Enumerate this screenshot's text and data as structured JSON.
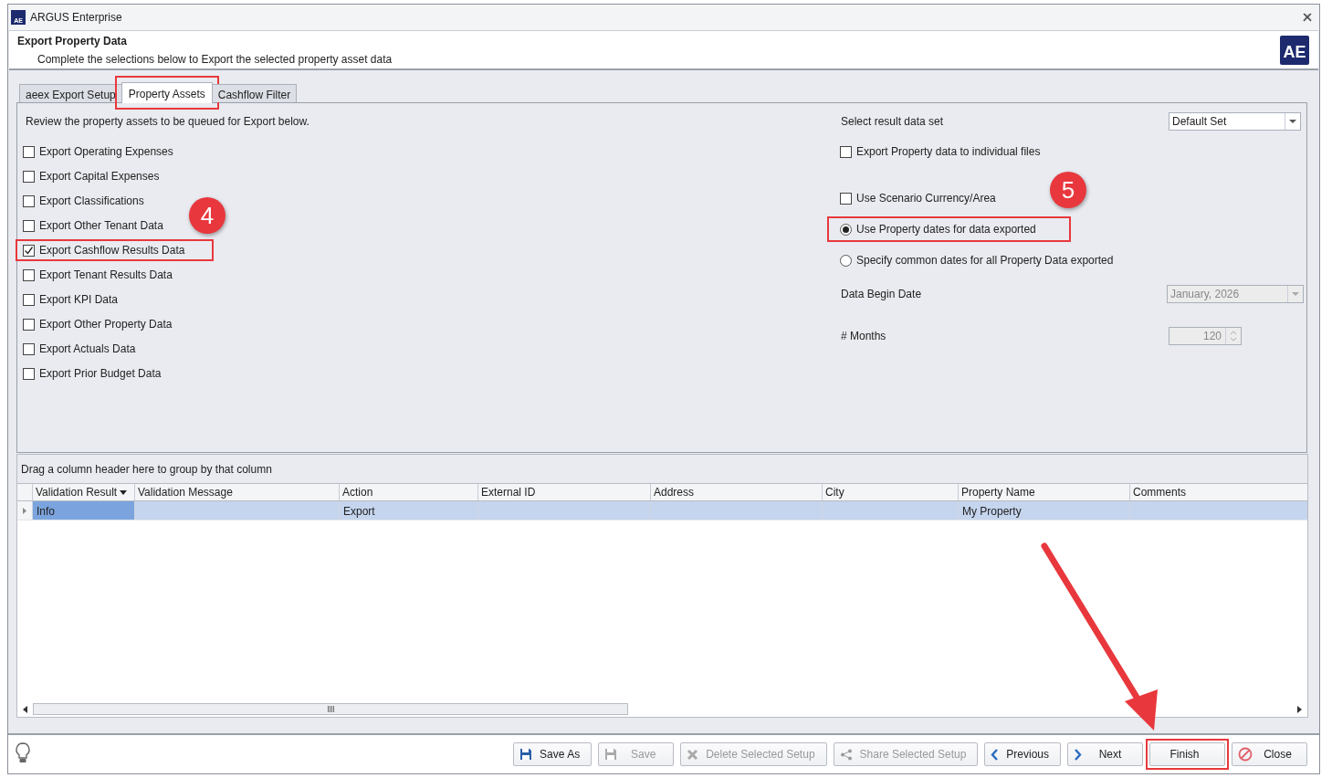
{
  "window": {
    "title": "ARGUS Enterprise",
    "app_icon": "AE"
  },
  "header": {
    "title": "Export Property Data",
    "subtitle": "Complete the selections below to Export the selected property asset data",
    "logo": "AE"
  },
  "tabs": [
    {
      "label": "aeex Export Setup",
      "selected": false,
      "highlighted": false
    },
    {
      "label": "Property Assets",
      "selected": true,
      "highlighted": true
    },
    {
      "label": "Cashflow Filter",
      "selected": false,
      "highlighted": false
    }
  ],
  "instructions": "Review the property assets to be queued for Export below.",
  "export_options": [
    {
      "label": "Export Operating Expenses",
      "checked": false,
      "highlighted": false
    },
    {
      "label": "Export Capital Expenses",
      "checked": false,
      "highlighted": false
    },
    {
      "label": "Export Classifications",
      "checked": false,
      "highlighted": false
    },
    {
      "label": "Export Other Tenant Data",
      "checked": false,
      "highlighted": false
    },
    {
      "label": "Export Cashflow Results Data",
      "checked": true,
      "highlighted": true
    },
    {
      "label": "Export Tenant Results Data",
      "checked": false,
      "highlighted": false
    },
    {
      "label": "Export KPI Data",
      "checked": false,
      "highlighted": false
    },
    {
      "label": "Export Other Property Data",
      "checked": false,
      "highlighted": false
    },
    {
      "label": "Export Actuals Data",
      "checked": false,
      "highlighted": false
    },
    {
      "label": "Export Prior Budget Data",
      "checked": false,
      "highlighted": false
    }
  ],
  "result_set": {
    "label": "Select result data set",
    "value": "Default Set"
  },
  "right_options": [
    {
      "kind": "checkbox",
      "label": "Export Property data to individual files",
      "checked": false,
      "highlighted": false
    },
    {
      "kind": "checkbox",
      "label": "Use Scenario Currency/Area",
      "checked": false,
      "highlighted": false
    },
    {
      "kind": "radio",
      "label": "Use Property dates for data exported",
      "selected": true,
      "highlighted": true
    },
    {
      "kind": "radio",
      "label": "Specify common dates for all Property Data exported",
      "selected": false,
      "highlighted": false
    }
  ],
  "begin_date": {
    "label": "Data Begin Date",
    "value": "January, 2026",
    "disabled": true
  },
  "months": {
    "label": "# Months",
    "value": "120",
    "disabled": true
  },
  "grid": {
    "group_hint": "Drag a column header here to group by that column",
    "columns": [
      {
        "label": "Validation Result"
      },
      {
        "label": "Validation Message"
      },
      {
        "label": "Action"
      },
      {
        "label": "External ID"
      },
      {
        "label": "Address"
      },
      {
        "label": "City"
      },
      {
        "label": "Property Name"
      },
      {
        "label": "Comments"
      }
    ],
    "rows": [
      {
        "selected": true,
        "cells": [
          {
            "text": "Info",
            "focused": true
          },
          {
            "focused": false
          },
          {
            "text": "Export",
            "focused": false
          },
          {
            "focused": false
          },
          {
            "focused": false
          },
          {
            "focused": false
          },
          {
            "text": "My Property",
            "focused": false
          },
          {
            "focused": false
          }
        ]
      }
    ]
  },
  "footer_buttons": [
    {
      "label": "Save As",
      "disabled": false,
      "highlighted": false
    },
    {
      "label": "Save",
      "disabled": true,
      "highlighted": false
    },
    {
      "label": "Delete Selected Setup",
      "disabled": true,
      "highlighted": false
    },
    {
      "label": "Share Selected Setup",
      "disabled": true,
      "highlighted": false
    },
    {
      "label": "Previous",
      "disabled": false,
      "highlighted": false
    },
    {
      "label": "Next",
      "disabled": false,
      "highlighted": false
    },
    {
      "label": "Finish",
      "disabled": false,
      "highlighted": true
    },
    {
      "label": "Close",
      "disabled": false,
      "highlighted": false
    }
  ],
  "callouts": [
    {
      "label": "4"
    },
    {
      "label": "5"
    }
  ]
}
